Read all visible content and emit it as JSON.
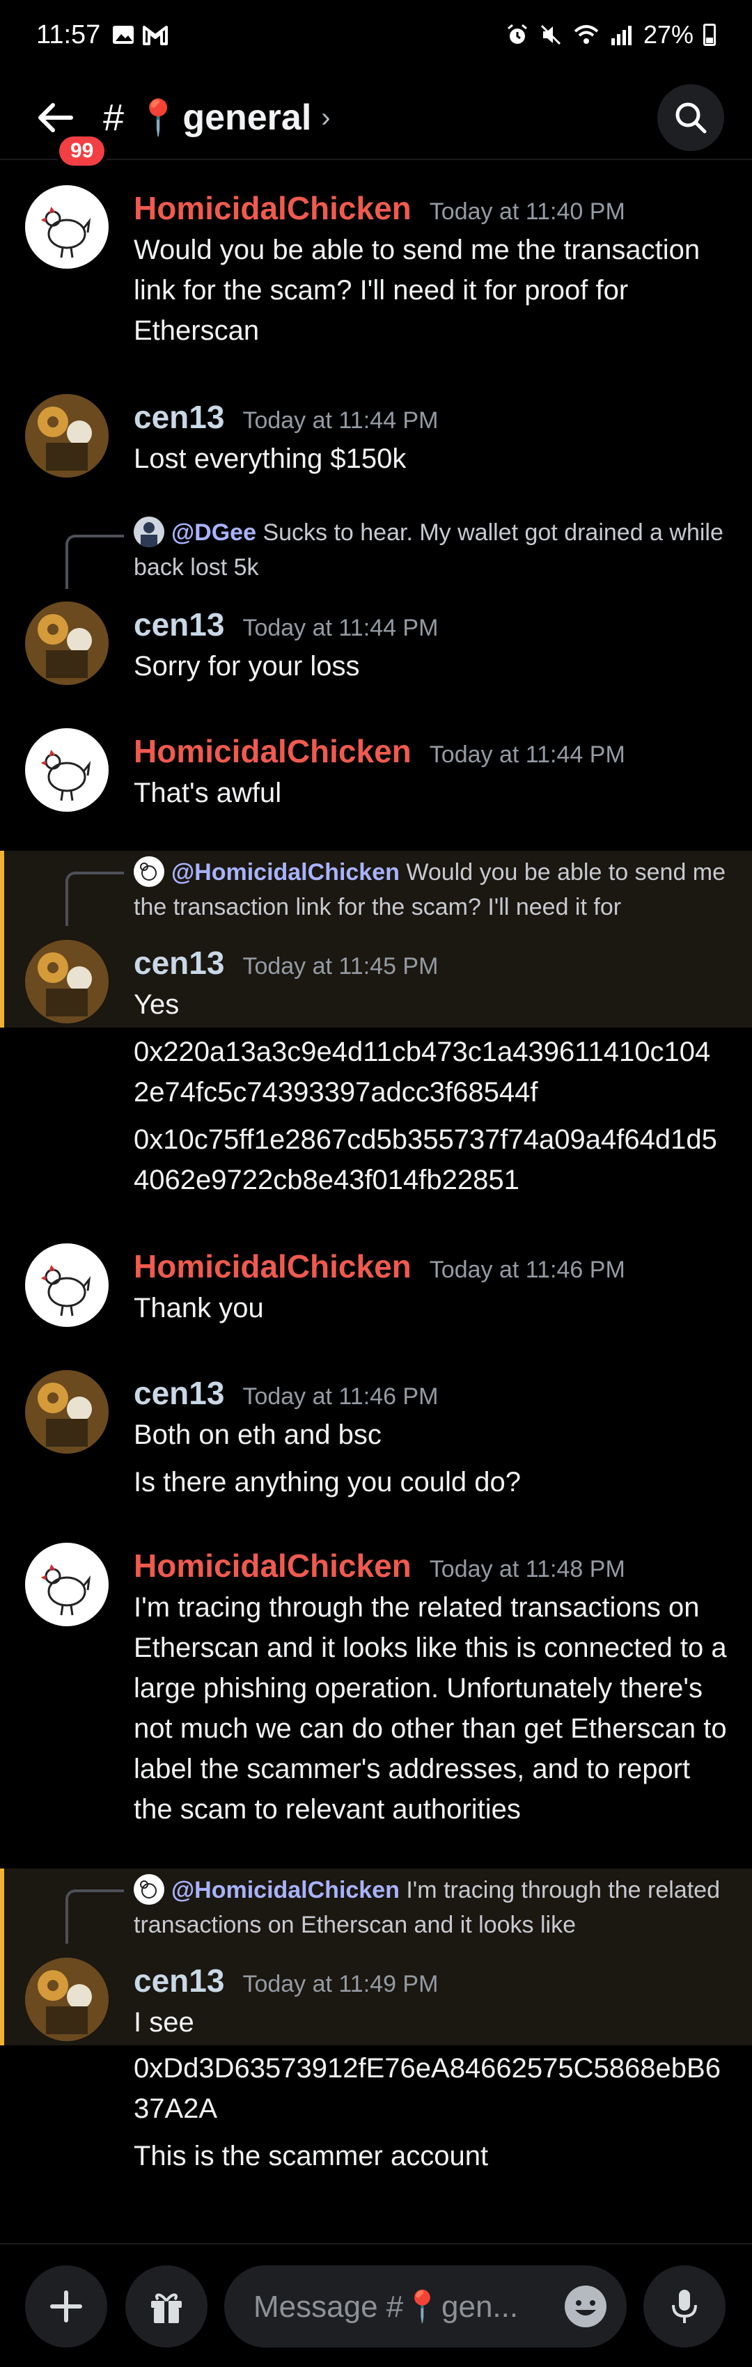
{
  "status": {
    "time": "11:57",
    "battery": "27%"
  },
  "header": {
    "badge": "99",
    "channel": "general",
    "pin": "📍"
  },
  "messages": [
    {
      "author": "HomicidalChicken",
      "time": "Today at 11:40 PM",
      "text": "Would you be able to send me the transaction link for the scam? I'll need it for proof for Etherscan"
    },
    {
      "author": "cen13",
      "time": "Today at 11:44 PM",
      "text": "Lost everything $150k"
    },
    {
      "reply_user": "@DGee",
      "reply_text": "Sucks to hear. My wallet got drained a while back lost 5k",
      "author": "cen13",
      "time": "Today at 11:44 PM",
      "text": "Sorry for your loss"
    },
    {
      "author": "HomicidalChicken",
      "time": "Today at 11:44 PM",
      "text": "That's awful"
    },
    {
      "reply_user": "@HomicidalChicken",
      "reply_text": "Would you be able to send me the transaction link for the scam? I'll need it for",
      "author": "cen13",
      "time": "Today at 11:45 PM",
      "text": "Yes",
      "extra1": "0x220a13a3c9e4d11cb473c1a439611410c1042e74fc5c74393397adcc3f68544f",
      "extra2": "0x10c75ff1e2867cd5b355737f74a09a4f64d1d54062e9722cb8e43f014fb22851"
    },
    {
      "author": "HomicidalChicken",
      "time": "Today at 11:46 PM",
      "text": "Thank you"
    },
    {
      "author": "cen13",
      "time": "Today at 11:46 PM",
      "text": "Both on eth and bsc",
      "extra1": "Is there anything you could do?"
    },
    {
      "author": "HomicidalChicken",
      "time": "Today at 11:48 PM",
      "text": "I'm tracing through the related transactions on Etherscan and it looks like this is connected to a large phishing operation. Unfortunately there's not much we can do other than get Etherscan to label the scammer's addresses, and to report the scam to relevant authorities"
    },
    {
      "reply_user": "@HomicidalChicken",
      "reply_text": "I'm tracing through the related transactions on Etherscan and it looks like",
      "author": "cen13",
      "time": "Today at 11:49 PM",
      "text": "I see",
      "extra1": "0xDd3D63573912fE76eA84662575C5868ebB637A2A",
      "extra2": "This is the scammer account"
    }
  ],
  "composer": {
    "placeholder": "Message #📍gen..."
  }
}
